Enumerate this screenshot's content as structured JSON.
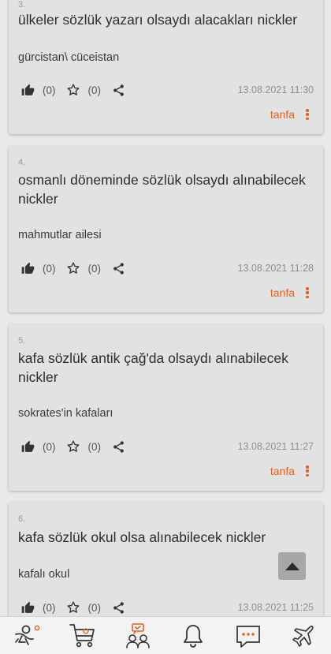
{
  "colors": {
    "accent": "#e5601c",
    "card": "#e2e2e2",
    "background": "#e9e9e9"
  },
  "entries": [
    {
      "number": "3.",
      "title": "ülkeler sözlük yazarı olsaydı alacakları nickler",
      "text": "gürcistan\\ cüceistan",
      "likes": "(0)",
      "favorites": "(0)",
      "date": "13.08.2021 11:30",
      "author": "tanfa"
    },
    {
      "number": "4.",
      "title": "osmanlı döneminde sözlük olsaydı alınabilecek nickler",
      "text": "mahmutlar ailesi",
      "likes": "(0)",
      "favorites": "(0)",
      "date": "13.08.2021 11:28",
      "author": "tanfa"
    },
    {
      "number": "5.",
      "title": "kafa sözlük antik çağ'da olsaydı alınabilecek nickler",
      "text": "sokrates'in kafaları",
      "likes": "(0)",
      "favorites": "(0)",
      "date": "13.08.2021 11:27",
      "author": "tanfa"
    },
    {
      "number": "6.",
      "title": "kafa sözlük okul olsa alınabilecek nickler",
      "text": "kafalı okul",
      "likes": "(0)",
      "favorites": "(0)",
      "date": "13.08.2021 11:25"
    }
  ],
  "icons": {
    "like": "thumbs-up-icon",
    "favorite": "star-icon",
    "share": "share-icon",
    "more": "kebab-menu-icon",
    "scroll_top": "caret-up-icon"
  },
  "bottom_nav": [
    "runner-icon",
    "cart-icon",
    "users-icon",
    "bell-icon",
    "chat-icon",
    "airplane-icon"
  ]
}
